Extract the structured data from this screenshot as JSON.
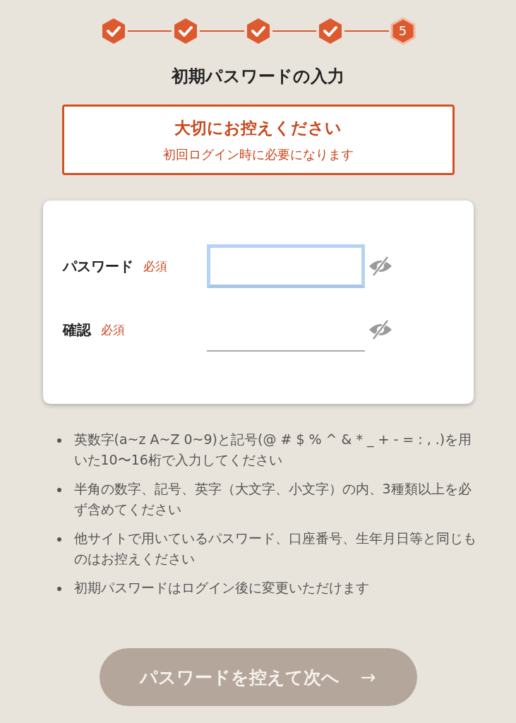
{
  "steps": [
    {
      "done": true
    },
    {
      "done": true
    },
    {
      "done": true
    },
    {
      "done": true
    },
    {
      "done": false,
      "label": "5"
    }
  ],
  "title": "初期パスワードの入力",
  "notice": {
    "heading": "大切にお控えください",
    "text": "初回ログイン時に必要になります"
  },
  "fields": [
    {
      "label": "パスワード",
      "required": "必須",
      "focused": true
    },
    {
      "label": "確認",
      "required": "必須",
      "focused": false
    }
  ],
  "notes": [
    "英数字(a~z A~Z 0~9)と記号(@ # $ % ^ & * _ + - = : , .)を用いた10〜16桁で入力してください",
    "半角の数字、記号、英字（大文字、小文字）の内、3種類以上を必ず含めてください",
    "他サイトで用いているパスワード、口座番号、生年月日等と同じものはお控えください",
    "初期パスワードはログイン後に変更いただけます"
  ],
  "next_button": {
    "label": "パスワードを控えて次へ",
    "arrow": "→",
    "disabled": true
  }
}
